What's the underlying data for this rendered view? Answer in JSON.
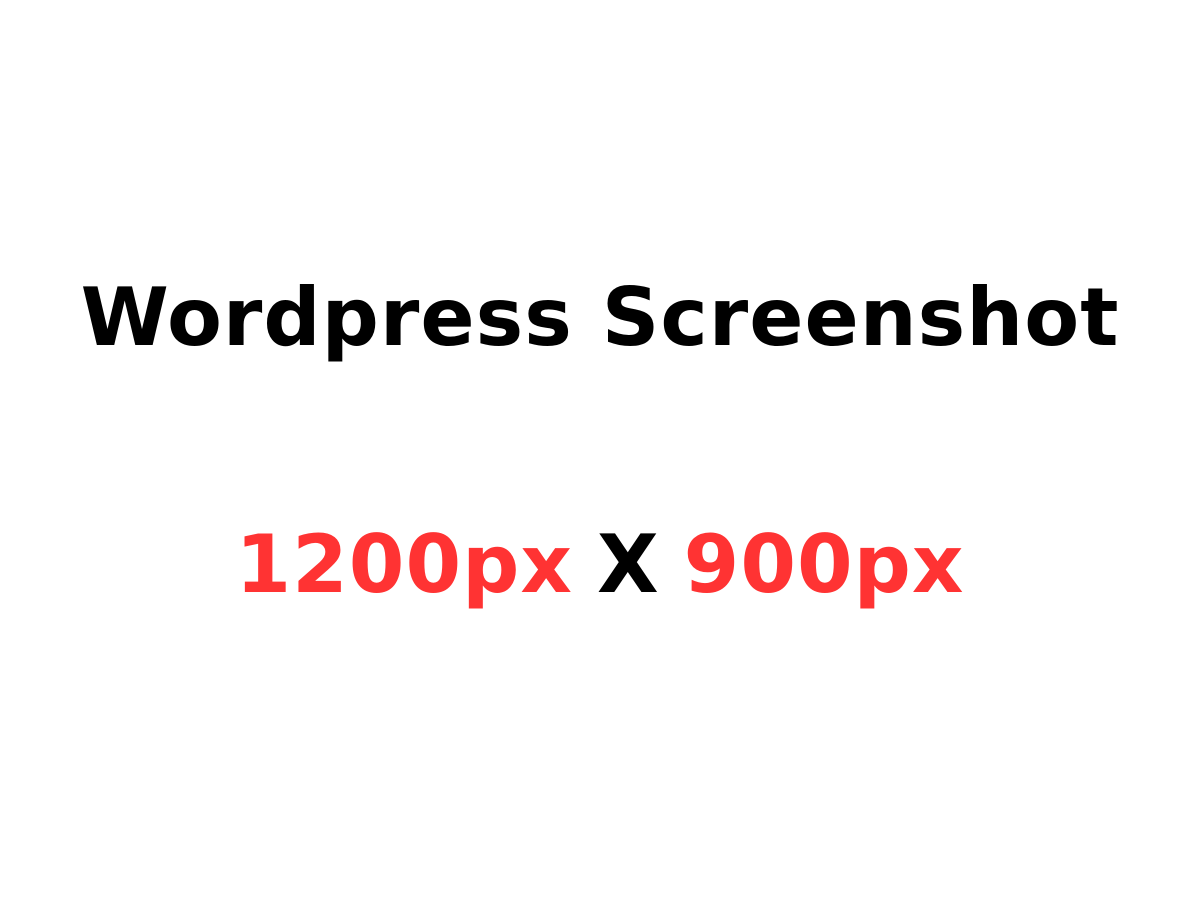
{
  "title": {
    "text": "Wordpress Screenshot",
    "color": "#000000"
  },
  "dimensions": {
    "width_text": "1200px",
    "separator": "X",
    "height_text": "900px",
    "accent_color": "#ff3333",
    "separator_color": "#000000"
  },
  "background_color": "#ffffff"
}
